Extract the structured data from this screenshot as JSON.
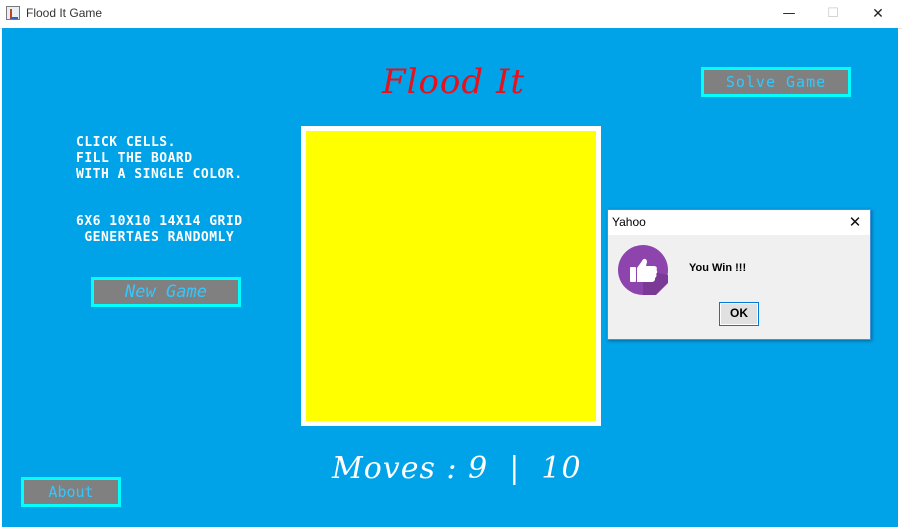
{
  "window": {
    "title": "Flood It Game",
    "controls": {
      "minimize": "—",
      "maximize": "☐",
      "close": "✕"
    }
  },
  "game": {
    "title": "Flood It",
    "solve_button": "Solve Game",
    "new_game_button": "New Game",
    "about_button": "About",
    "instructions": [
      "CLICK CELLS.",
      "FILL THE BOARD",
      "WITH A SINGLE COLOR."
    ],
    "grid_info": [
      "6X6 10X10 14X14 GRID",
      " GENERTAES RANDOMLY"
    ],
    "board_color": "#ffff00",
    "moves_label": "Moves : ",
    "moves_current": "9",
    "moves_separator": "  |  ",
    "moves_max": "10"
  },
  "dialog": {
    "title": "Yahoo",
    "close": "✕",
    "icon": "thumbs-up-icon",
    "message": "You Win !!!",
    "ok_button": "OK"
  },
  "colors": {
    "panel_background": "#00a2e8",
    "title_red": "#e8101a",
    "button_border": "#00ffff",
    "button_fill": "#808080",
    "icon_purple": "#8e44ad"
  }
}
